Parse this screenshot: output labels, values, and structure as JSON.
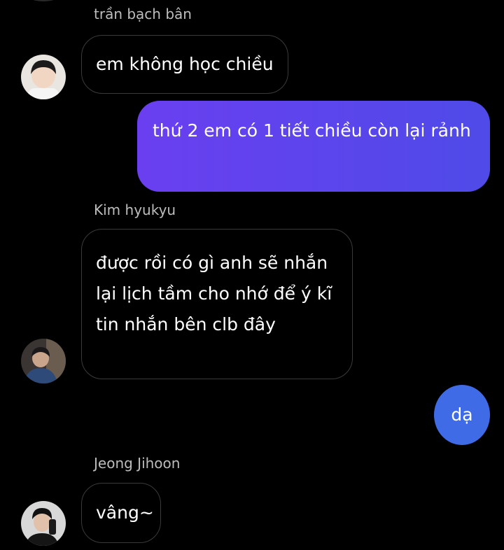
{
  "messages": [
    {
      "sender": "trần bạch bân",
      "text": "em không học chiều"
    },
    {
      "self": true,
      "text": "thứ 2 em có 1 tiết chiều còn lại rảnh"
    },
    {
      "sender": "Kim hyukyu",
      "text": "được rồi có gì anh sẽ nhắn lại lịch tầm cho nhớ để ý kĩ tin nhắn bên clb đây"
    },
    {
      "self": true,
      "text": "dạ"
    },
    {
      "sender": "Jeong Jihoon",
      "text": "vâng~"
    }
  ],
  "colors": {
    "outgoing_gradient_start": "#6a3ff0",
    "outgoing_gradient_end": "#4f4ae8",
    "outgoing_single": "#3f6ce6",
    "incoming_border": "#3a3a3c",
    "sender_name": "#bdbdbd",
    "background": "#000000"
  }
}
